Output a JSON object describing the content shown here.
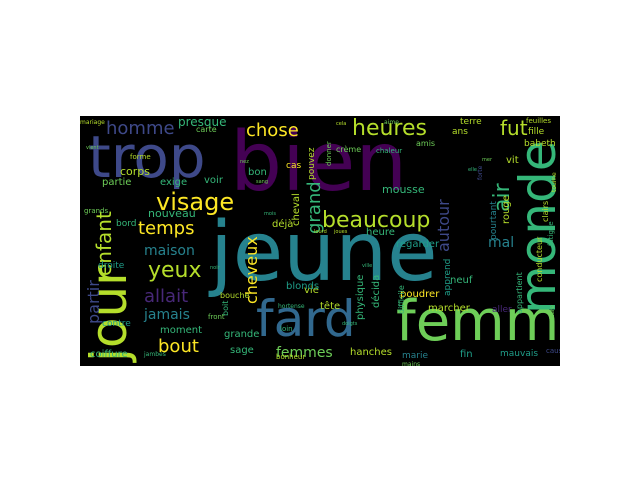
{
  "palette": {
    "background": "#000000",
    "purple_dark": "#440154",
    "purple": "#482878",
    "indigo": "#3e4989",
    "blue": "#31688e",
    "teal_blue": "#26828e",
    "teal": "#1f9e89",
    "green_teal": "#35b779",
    "green": "#6ece58",
    "yellow_green": "#b5de2b",
    "yellow": "#fde725"
  },
  "words": {
    "jeune": "jeune",
    "bien": "bien",
    "femme": "femme",
    "trop": "trop",
    "monde": "monde",
    "jour": "jour",
    "fard": "fard",
    "visage": "visage",
    "heures": "heures",
    "beaucoup": "beaucoup",
    "yeux": "yeux",
    "enfant": "enfant",
    "homme": "homme",
    "chose": "chose",
    "fut": "fut",
    "air": "air",
    "temps": "temps",
    "allait": "allait",
    "bout": "bout",
    "grand": "grand",
    "autour": "autour",
    "cheveux": "cheveux",
    "partir": "partir",
    "maison": "maison",
    "jamais": "jamais",
    "femmes": "femmes",
    "mal": "mal",
    "presque": "presque",
    "nouveau": "nouveau",
    "corps": "corps",
    "exige": "exige",
    "partie": "partie",
    "voir": "voir",
    "bon": "bon",
    "cas": "cas",
    "cheval": "cheval",
    "deja": "déjà",
    "vie": "vie",
    "tete": "tête",
    "blonds": "blonds",
    "physique": "physique",
    "decida": "décida",
    "mousse": "mousse",
    "heure": "heure",
    "regarder": "regarder",
    "neuf": "neuf",
    "vit": "vit",
    "rouge": "rouge",
    "pourtant": "pourtant",
    "ans": "ans",
    "terre": "terre",
    "fille": "fille",
    "babeth": "babeth",
    "apprend": "apprend",
    "poudrer": "poudrer",
    "marcher": "marcher",
    "aller": "aller",
    "fin": "fin",
    "mauvais": "mauvais",
    "marie": "marie",
    "hanches": "hanches",
    "grande": "grande",
    "sage": "sage",
    "coiffure": "coiffure",
    "moment": "moment",
    "contre": "contre",
    "droite": "droite",
    "bord": "bord",
    "carte": "carte",
    "creme": "crème",
    "amis": "amis",
    "chaleur": "chaleur",
    "appartient": "appartient",
    "conducteur": "conducteur",
    "clairs": "clairs",
    "feuilles": "feuilles",
    "mariage": "mariage",
    "grands": "grands",
    "forme": "forme",
    "bouche": "bouche",
    "boit": "boit",
    "front": "front",
    "pouvez": "pouvez",
    "donner": "donner",
    "difficile": "difficile",
    "bonheur": "bonheur",
    "loin": "loin",
    "hortense": "hortense",
    "jambes": "jambes",
    "mains": "mains",
    "fatigue": "fatigue",
    "culture": "culture",
    "cause": "cause",
    "forte": "forte",
    "tourne": "tourne",
    "aime": "aime",
    "cela": "cela",
    "nez": "nez",
    "mois": "mois",
    "lourd": "lourd",
    "joues": "joues",
    "doigts": "doigts",
    "sang": "sang",
    "noir": "noir",
    "vient": "vient",
    "elle": "elle",
    "mer": "mer",
    "ville": "ville"
  }
}
